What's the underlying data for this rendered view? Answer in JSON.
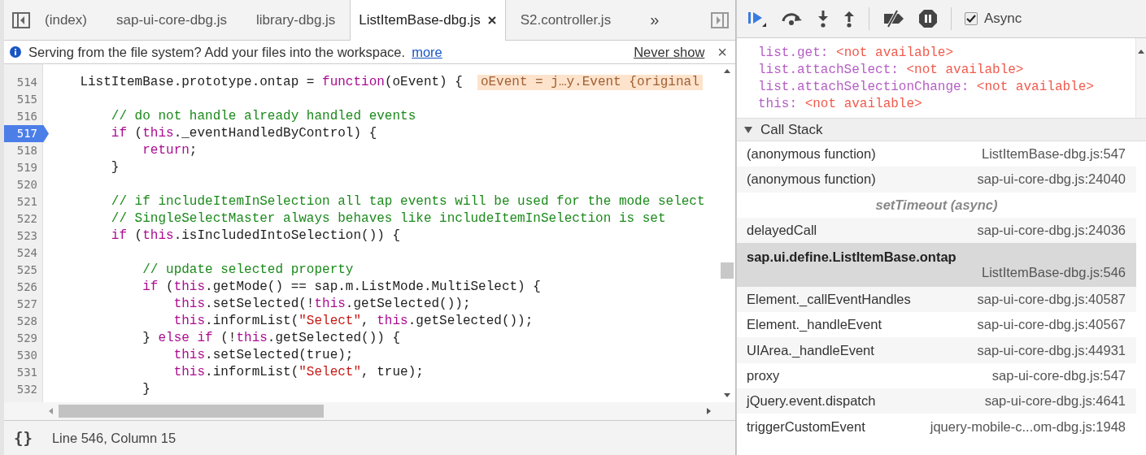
{
  "editor": {
    "tabs": [
      {
        "label": "(index)",
        "selected": false
      },
      {
        "label": "sap-ui-core-dbg.js",
        "selected": false
      },
      {
        "label": "library-dbg.js",
        "selected": false
      },
      {
        "label": "ListItemBase-dbg.js",
        "selected": true
      },
      {
        "label": "S2.controller.js",
        "selected": false
      }
    ],
    "more_tabs": "»",
    "infobar": {
      "message": "Serving from the file system? Add your files into the workspace.",
      "link": "more",
      "dismiss": "Never show",
      "close": "×"
    },
    "lines": [
      {
        "number": "514",
        "breakpoint": false,
        "tokens": [
          {
            "kind": "plain",
            "text": "    ListItemBase.prototype.ontap = "
          },
          {
            "kind": "keyword",
            "text": "function"
          },
          {
            "kind": "plain",
            "text": "(oEvent) {"
          }
        ],
        "inline_value": "oEvent = j…y.Event {original"
      },
      {
        "number": "515",
        "breakpoint": false
      },
      {
        "number": "516",
        "breakpoint": false,
        "tokens": [
          {
            "kind": "comment",
            "text": "        // do not handle already handled events"
          }
        ]
      },
      {
        "number": "517",
        "breakpoint": true,
        "tokens": [
          {
            "kind": "keyword",
            "text": "        if"
          },
          {
            "kind": "plain",
            "text": " ("
          },
          {
            "kind": "keyword",
            "text": "this"
          },
          {
            "kind": "plain",
            "text": "._eventHandledByControl) {"
          }
        ]
      },
      {
        "number": "518",
        "breakpoint": false,
        "tokens": [
          {
            "kind": "keyword",
            "text": "            return"
          },
          {
            "kind": "plain",
            "text": ";"
          }
        ]
      },
      {
        "number": "519",
        "breakpoint": false,
        "tokens": [
          {
            "kind": "plain",
            "text": "        }"
          }
        ]
      },
      {
        "number": "520",
        "breakpoint": false
      },
      {
        "number": "521",
        "breakpoint": false,
        "tokens": [
          {
            "kind": "comment",
            "text": "        // if includeItemInSelection all tap events will be used for the mode select"
          }
        ]
      },
      {
        "number": "522",
        "breakpoint": false,
        "tokens": [
          {
            "kind": "comment",
            "text": "        // SingleSelectMaster always behaves like includeItemInSelection is set"
          }
        ]
      },
      {
        "number": "523",
        "breakpoint": false,
        "tokens": [
          {
            "kind": "keyword",
            "text": "        if"
          },
          {
            "kind": "plain",
            "text": " ("
          },
          {
            "kind": "keyword",
            "text": "this"
          },
          {
            "kind": "plain",
            "text": ".isIncludedIntoSelection()) {"
          }
        ]
      },
      {
        "number": "524",
        "breakpoint": false
      },
      {
        "number": "525",
        "breakpoint": false,
        "tokens": [
          {
            "kind": "comment",
            "text": "            // update selected property"
          }
        ]
      },
      {
        "number": "526",
        "breakpoint": false,
        "tokens": [
          {
            "kind": "keyword",
            "text": "            if"
          },
          {
            "kind": "plain",
            "text": " ("
          },
          {
            "kind": "keyword",
            "text": "this"
          },
          {
            "kind": "plain",
            "text": ".getMode() == sap.m.ListMode.MultiSelect) {"
          }
        ]
      },
      {
        "number": "527",
        "breakpoint": false,
        "tokens": [
          {
            "kind": "keyword",
            "text": "                this"
          },
          {
            "kind": "plain",
            "text": ".setSelected(!"
          },
          {
            "kind": "keyword",
            "text": "this"
          },
          {
            "kind": "plain",
            "text": ".getSelected());"
          }
        ]
      },
      {
        "number": "528",
        "breakpoint": false,
        "tokens": [
          {
            "kind": "keyword",
            "text": "                this"
          },
          {
            "kind": "plain",
            "text": ".informList("
          },
          {
            "kind": "string",
            "text": "\"Select\""
          },
          {
            "kind": "plain",
            "text": ", "
          },
          {
            "kind": "keyword",
            "text": "this"
          },
          {
            "kind": "plain",
            "text": ".getSelected());"
          }
        ]
      },
      {
        "number": "529",
        "breakpoint": false,
        "tokens": [
          {
            "kind": "plain",
            "text": "            } "
          },
          {
            "kind": "keyword",
            "text": "else if"
          },
          {
            "kind": "plain",
            "text": " (!"
          },
          {
            "kind": "keyword",
            "text": "this"
          },
          {
            "kind": "plain",
            "text": ".getSelected()) {"
          }
        ]
      },
      {
        "number": "530",
        "breakpoint": false,
        "tokens": [
          {
            "kind": "keyword",
            "text": "                this"
          },
          {
            "kind": "plain",
            "text": ".setSelected(true);"
          }
        ]
      },
      {
        "number": "531",
        "breakpoint": false,
        "tokens": [
          {
            "kind": "keyword",
            "text": "                this"
          },
          {
            "kind": "plain",
            "text": ".informList("
          },
          {
            "kind": "string",
            "text": "\"Select\""
          },
          {
            "kind": "plain",
            "text": ", true);"
          }
        ]
      },
      {
        "number": "532",
        "breakpoint": false,
        "tokens": [
          {
            "kind": "plain",
            "text": "            }"
          }
        ]
      }
    ],
    "status": {
      "pretty_print": "{}",
      "position": "Line 546, Column 15"
    }
  },
  "debugger": {
    "async": {
      "label": "Async",
      "checked": true
    },
    "scope": [
      {
        "name": "list.get:",
        "value": "<not available>"
      },
      {
        "name": "list.attachSelect:",
        "value": "<not available>"
      },
      {
        "name": "list.attachSelectionChange:",
        "value": "<not available>"
      },
      {
        "name": "this:",
        "value": "<not available>"
      }
    ],
    "call_stack": {
      "title": "Call Stack",
      "expanded": true,
      "frames": [
        {
          "kind": "frame",
          "function": "(anonymous function)",
          "location": "ListItemBase-dbg.js:547",
          "selected": false
        },
        {
          "kind": "frame",
          "function": "(anonymous function)",
          "location": "sap-ui-core-dbg.js:24040",
          "selected": false
        },
        {
          "kind": "async",
          "label": "setTimeout (async)"
        },
        {
          "kind": "frame",
          "function": "delayedCall",
          "location": "sap-ui-core-dbg.js:24036",
          "selected": false
        },
        {
          "kind": "frame",
          "function": "sap.ui.define.ListItemBase.ontap",
          "location": "ListItemBase-dbg.js:546",
          "selected": true
        },
        {
          "kind": "frame",
          "function": "Element._callEventHandles",
          "location": "sap-ui-core-dbg.js:40587",
          "selected": false
        },
        {
          "kind": "frame",
          "function": "Element._handleEvent",
          "location": "sap-ui-core-dbg.js:40567",
          "selected": false
        },
        {
          "kind": "frame",
          "function": "UIArea._handleEvent",
          "location": "sap-ui-core-dbg.js:44931",
          "selected": false
        },
        {
          "kind": "frame",
          "function": "proxy",
          "location": "sap-ui-core-dbg.js:547",
          "selected": false
        },
        {
          "kind": "frame",
          "function": "jQuery.event.dispatch",
          "location": "sap-ui-core-dbg.js:4641",
          "selected": false
        },
        {
          "kind": "frame",
          "function": "triggerCustomEvent",
          "location": "jquery-mobile-c...om-dbg.js:1948",
          "selected": false
        }
      ]
    }
  }
}
